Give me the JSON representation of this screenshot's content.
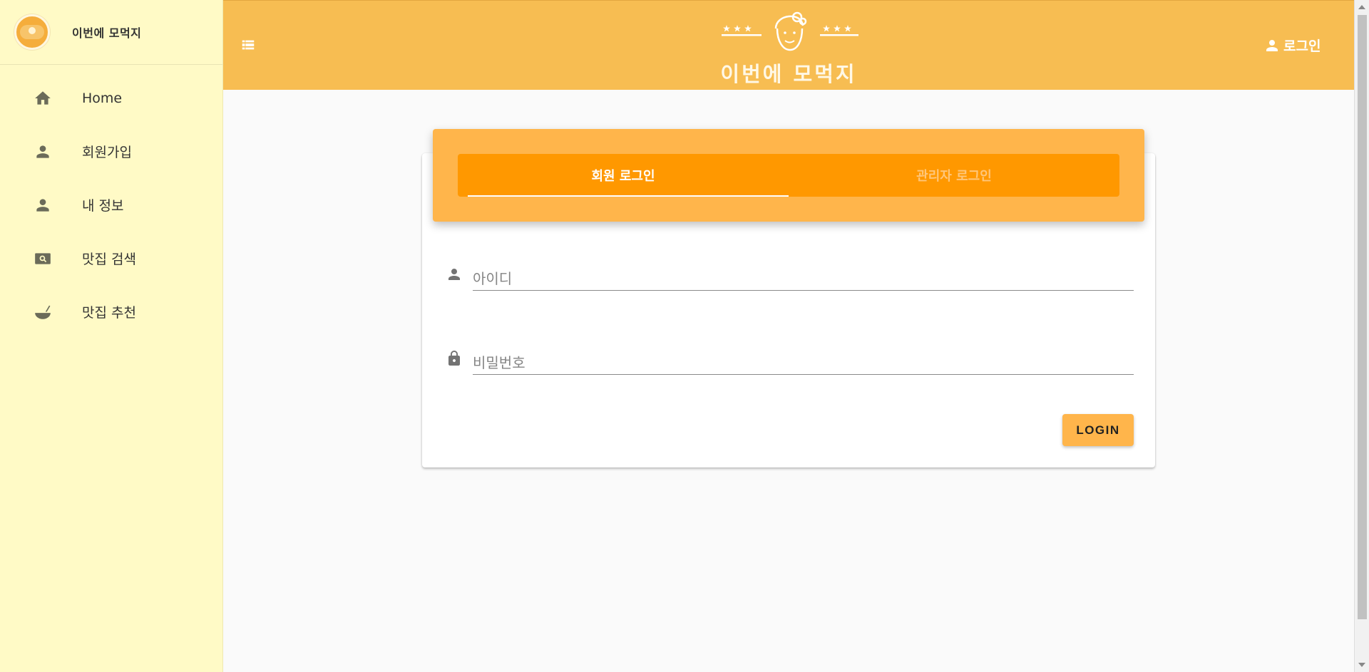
{
  "brand": {
    "title": "이번에 모먹지"
  },
  "sidebar": {
    "items": [
      {
        "label": "Home",
        "icon": "home-icon"
      },
      {
        "label": "회원가입",
        "icon": "person-icon"
      },
      {
        "label": "내 정보",
        "icon": "person-icon"
      },
      {
        "label": "맛집 검색",
        "icon": "image-search-icon"
      },
      {
        "label": "맛집 추천",
        "icon": "bowl-icon"
      }
    ]
  },
  "header": {
    "title": "이번에 모먹지",
    "login_label": "로그인",
    "menu_icon": "list-view-icon",
    "colors": {
      "bar": "#f7bd52",
      "sidebar": "#fffac6"
    }
  },
  "login_card": {
    "tabs": [
      {
        "label": "회원 로그인",
        "active": true
      },
      {
        "label": "관리자 로그인",
        "active": false
      }
    ],
    "username": {
      "placeholder": "아이디",
      "value": ""
    },
    "password": {
      "placeholder": "비밀번호",
      "value": ""
    },
    "submit_label": "LOGIN",
    "colors": {
      "header": "#ffb54b",
      "tabs": "#ff9800"
    }
  }
}
